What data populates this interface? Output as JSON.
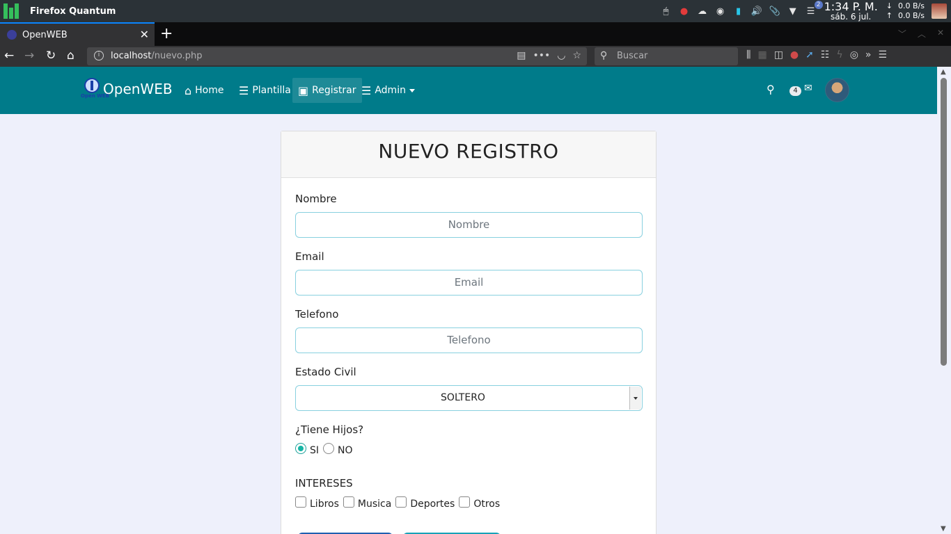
{
  "os": {
    "app_name": "Firefox Quantum",
    "notification_count": "2",
    "time": "1:34 P. M.",
    "date": "sáb. 6 jul.",
    "net_down": "0.0 B/s",
    "net_up": "0.0 B/s"
  },
  "browser": {
    "tab_title": "OpenWEB",
    "url_host": "localhost",
    "url_path": "/nuevo.php",
    "search_placeholder": "Buscar"
  },
  "site": {
    "brand": "OpenWEB",
    "brand_tag": "Open WEB",
    "nav": [
      {
        "label": "Home",
        "icon": "home-icon"
      },
      {
        "label": "Plantilla",
        "icon": "server-icon"
      },
      {
        "label": "Registrar",
        "icon": "save-icon"
      },
      {
        "label": "Admin",
        "icon": "sliders-icon"
      }
    ],
    "message_count": "4"
  },
  "form": {
    "title": "NUEVO REGISTRO",
    "name_label": "Nombre",
    "name_placeholder": "Nombre",
    "email_label": "Email",
    "email_placeholder": "Email",
    "phone_label": "Telefono",
    "phone_placeholder": "Telefono",
    "civil_label": "Estado Civil",
    "civil_value": "SOLTERO",
    "children_label": "¿Tiene Hijos?",
    "children_options": [
      "SI",
      "NO"
    ],
    "children_selected": "SI",
    "interests_label": "INTERESES",
    "interests": [
      "Libros",
      "Musica",
      "Deportes",
      "Otros"
    ]
  }
}
